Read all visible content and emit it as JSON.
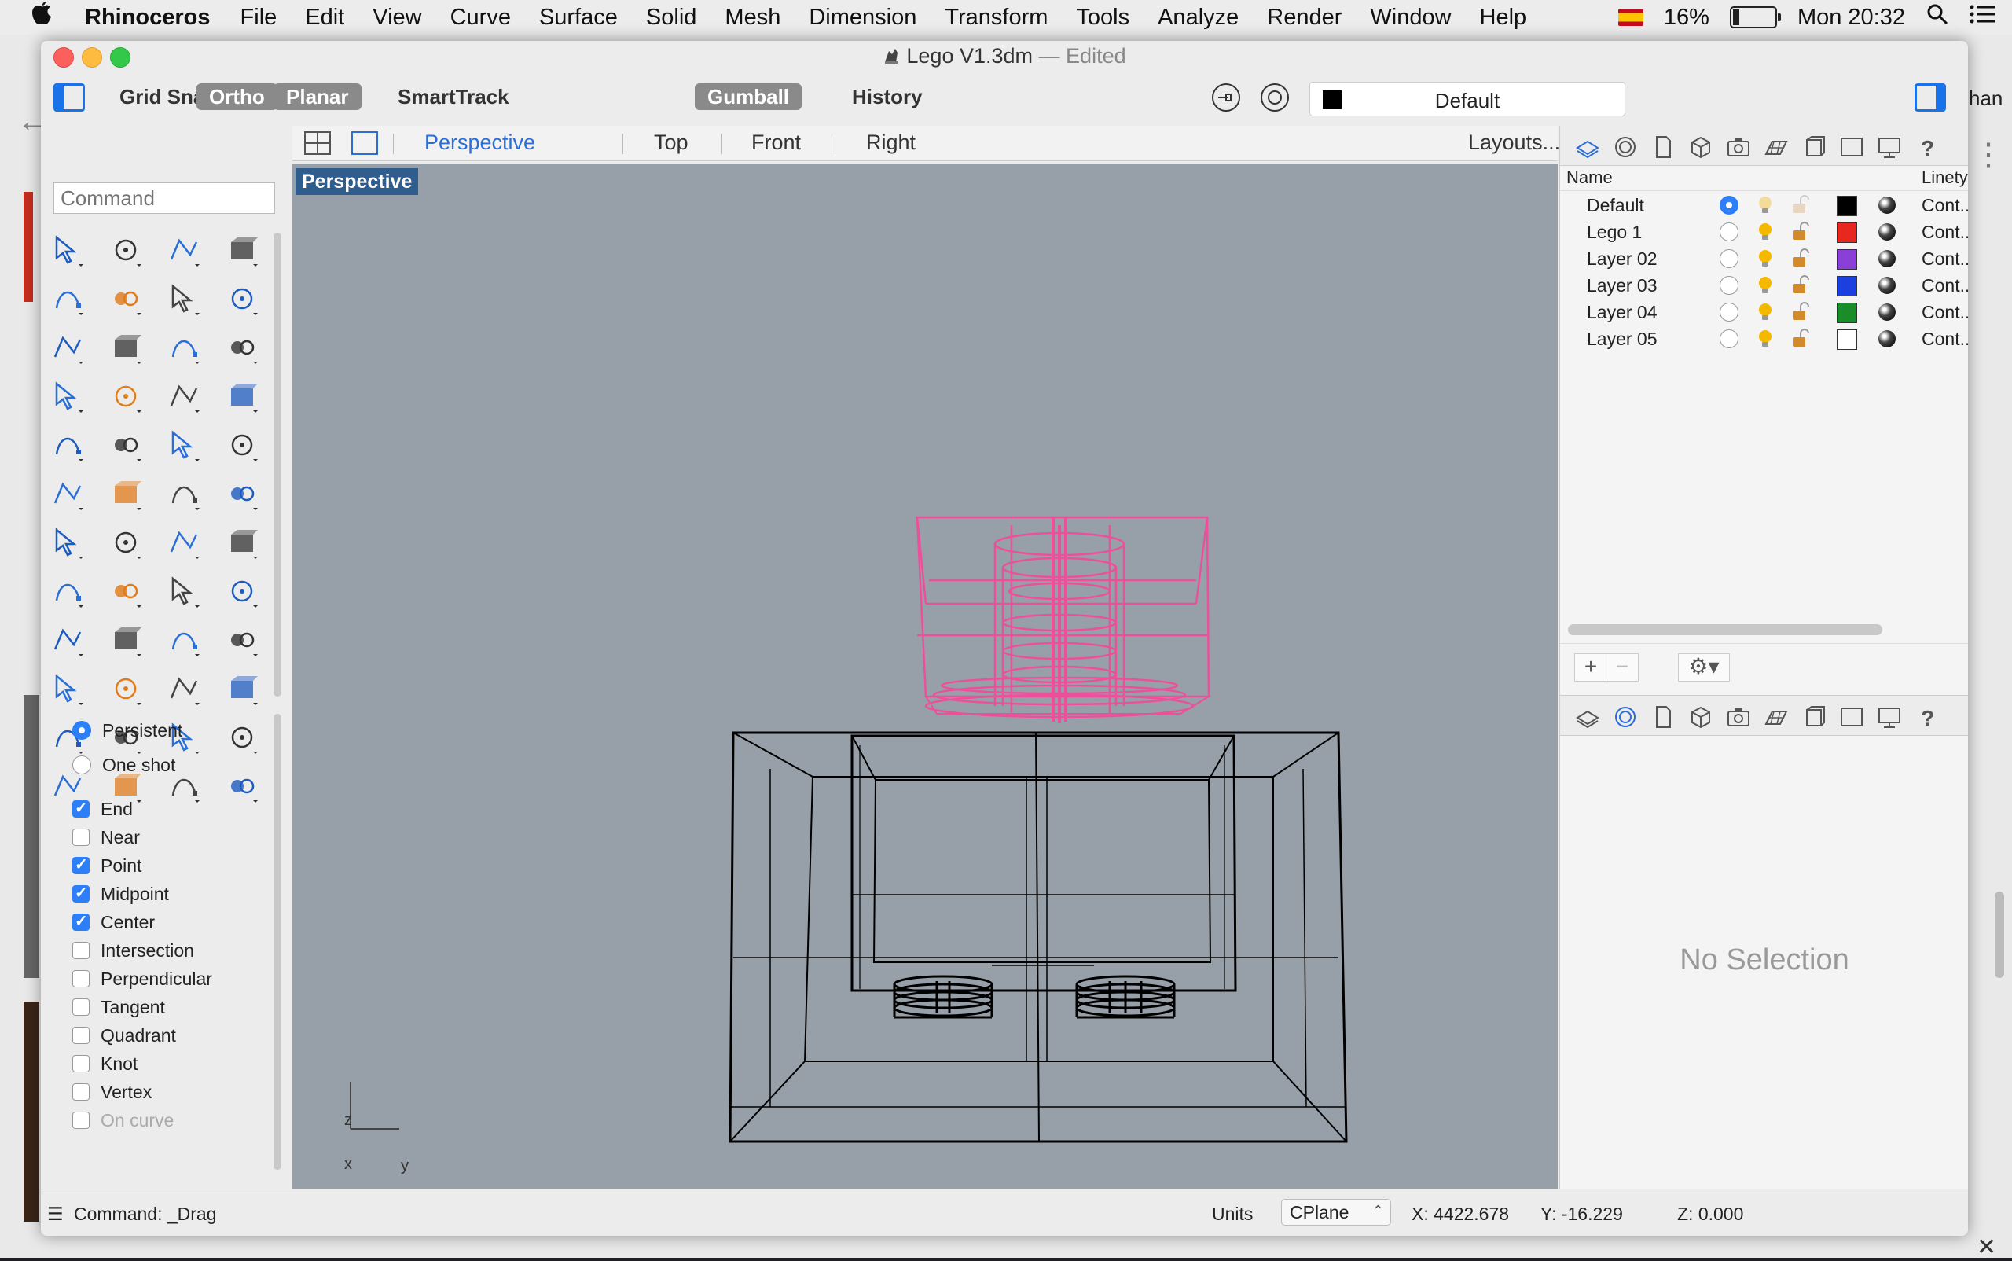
{
  "menubar": {
    "app": "Rhinoceros",
    "menus": [
      "File",
      "Edit",
      "View",
      "Curve",
      "Surface",
      "Solid",
      "Mesh",
      "Dimension",
      "Transform",
      "Tools",
      "Analyze",
      "Render",
      "Window",
      "Help"
    ],
    "battery": "16%",
    "battery_level": 0.16,
    "clock": "Mon 20:32"
  },
  "window": {
    "title": "Lego V1.3dm",
    "title_sep": "—",
    "title_state": "Edited"
  },
  "toolbar": {
    "grid_snap": "Grid Snap",
    "ortho": "Ortho",
    "planar": "Planar",
    "smarttrack": "SmartTrack",
    "gumball": "Gumball",
    "history": "History",
    "layer_name": "Default",
    "layer_color": "#000000"
  },
  "command": {
    "placeholder": "Command"
  },
  "osnap": {
    "modes": [
      {
        "label": "Persistent",
        "selected": true
      },
      {
        "label": "One shot",
        "selected": false
      }
    ],
    "snaps": [
      {
        "label": "End",
        "checked": true
      },
      {
        "label": "Near",
        "checked": false
      },
      {
        "label": "Point",
        "checked": true
      },
      {
        "label": "Midpoint",
        "checked": true
      },
      {
        "label": "Center",
        "checked": true
      },
      {
        "label": "Intersection",
        "checked": false
      },
      {
        "label": "Perpendicular",
        "checked": false
      },
      {
        "label": "Tangent",
        "checked": false
      },
      {
        "label": "Quadrant",
        "checked": false
      },
      {
        "label": "Knot",
        "checked": false
      },
      {
        "label": "Vertex",
        "checked": false
      },
      {
        "label": "On curve",
        "checked": false
      }
    ]
  },
  "viewtabs": {
    "tabs": [
      "Perspective",
      "Top",
      "Front",
      "Right"
    ],
    "active": "Perspective",
    "layouts": "Layouts..."
  },
  "viewport": {
    "label": "Perspective",
    "axis_z": "z",
    "axis_x": "x",
    "axis_y": "y",
    "selected_color": "#ee4f9a",
    "object_color": "#000000"
  },
  "layers": {
    "header_name": "Name",
    "header_linetype": "Linetyp",
    "rows": [
      {
        "name": "Default",
        "current": true,
        "color": "#000000",
        "linetype": "Cont..."
      },
      {
        "name": "Lego 1",
        "current": false,
        "color": "#e8281e",
        "linetype": "Cont..."
      },
      {
        "name": "Layer 02",
        "current": false,
        "color": "#8a3fd6",
        "linetype": "Cont..."
      },
      {
        "name": "Layer 03",
        "current": false,
        "color": "#1c3fe0",
        "linetype": "Cont..."
      },
      {
        "name": "Layer 04",
        "current": false,
        "color": "#1a8c2a",
        "linetype": "Cont..."
      },
      {
        "name": "Layer 05",
        "current": false,
        "color": "#ffffff",
        "linetype": "Cont..."
      }
    ],
    "add": "+",
    "remove": "−"
  },
  "properties": {
    "empty_text": "No Selection"
  },
  "status": {
    "command": "Command: _Drag",
    "units": "Units",
    "cplane": "CPlane",
    "x": "X: 4422.678",
    "y": "Y: -16.229",
    "z": "Z: 0.000"
  },
  "background_window": {
    "visible_text": "han"
  }
}
